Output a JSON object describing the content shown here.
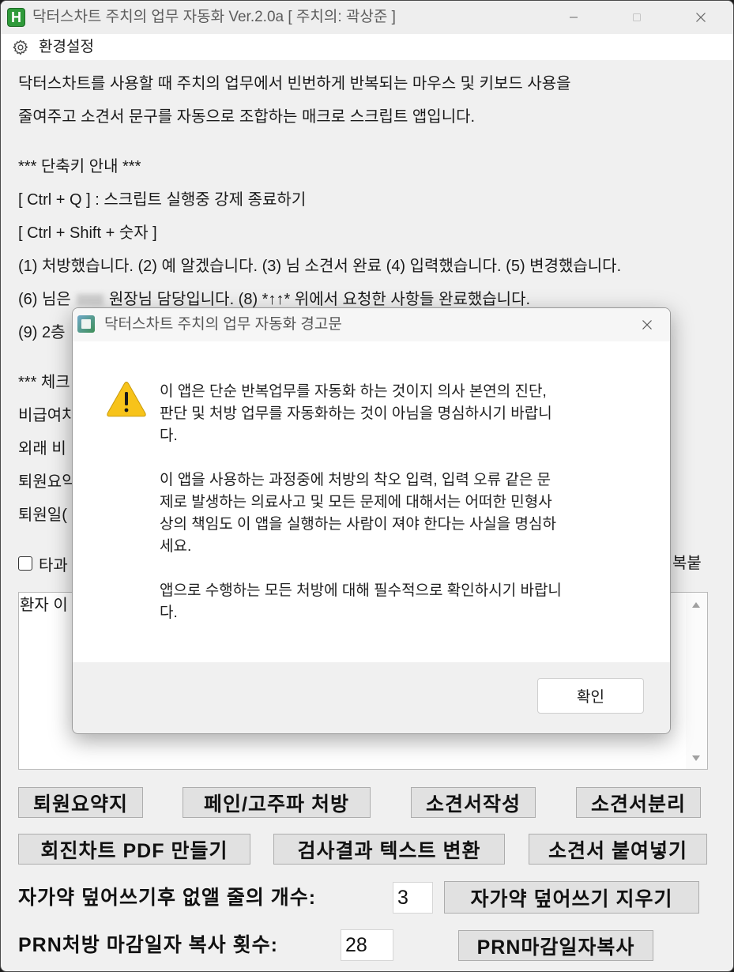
{
  "window": {
    "title": "닥터스차트 주치의 업무 자동화 Ver.2.0a [ 주치의: 곽상준 ]",
    "icon_letter": "H",
    "icon": "app-icon",
    "controls": [
      "minimize-icon",
      "maximize-icon",
      "close-icon"
    ]
  },
  "menu": {
    "settings": {
      "label": "환경설정",
      "icon": "gear-icon"
    }
  },
  "intro": [
    "닥터스차트를 사용할 때 주치의 업무에서 빈번하게 반복되는 마우스 및 키보드 사용을",
    "줄여주고 소견서 문구를 자동으로 조합하는 매크로 스크립트 앱입니다."
  ],
  "shortcuts": {
    "heading": "*** 단축키 안내 ***",
    "force_quit": "[ Ctrl + Q ] : 스크립트 실행중 강제 종료하기",
    "combo": "[ Ctrl + Shift + 숫자 ]",
    "phrases_line1": "(1) 처방했습니다. (2) 예 알겠습니다. (3) 님 소견서 완료 (4) 입력했습니다. (5) 변경했습니다.",
    "phrases_line2_before_name": "(6) 님은",
    "phrases_line2_after_name": "원장님 담당입니다. (8) *↑↑* 위에서 요청한 사항들 완료했습니다.",
    "phrases_line3": "(9) 2층"
  },
  "check_section": {
    "heading": "*** 체크",
    "lines": [
      "비급여차",
      "외래 비",
      "퇴원요약",
      "퇴원일("
    ]
  },
  "options": {
    "other_dept_checkbox": {
      "label": "타과",
      "checked": false
    },
    "right_label": "복붙"
  },
  "patient_box": {
    "text": "환자 이"
  },
  "buttons": {
    "row1": [
      "퇴원요약지",
      "페인/고주파 처방",
      "소견서작성",
      "소견서분리"
    ],
    "row2": [
      "회진차트 PDF 만들기",
      "검사결과 텍스트 변환",
      "소견서 붙여넣기"
    ]
  },
  "overwrite": {
    "label": "자가약 덮어쓰기후 없앨 줄의 개수:",
    "value": "3",
    "button": "자가약 덮어쓰기 지우기"
  },
  "prn": {
    "label": "PRN처방 마감일자 복사 횟수:",
    "value": "28",
    "button": "PRN마감일자복사"
  },
  "dialog": {
    "title": "닥터스차트 주치의 업무 자동화 경고문",
    "icon": "warning-icon",
    "paragraphs": [
      [
        "이 앱은 단순 반복업무를 자동화 하는 것이지 의사 본연의 진단,",
        "판단 및 처방 업무를 자동화하는 것이 아님을 명심하시기 바랍니",
        "다."
      ],
      [
        "이 앱을 사용하는 과정중에 처방의 착오 입력, 입력 오류 같은 문",
        "제로 발생하는 의료사고 및 모든 문제에 대해서는 어떠한 민형사",
        "상의 책임도 이 앱을 실행하는 사람이 져야 한다는 사실을 명심하",
        "세요."
      ],
      [
        "앱으로 수행하는 모든 처방에 대해 필수적으로 확인하시기 바랍니",
        "다."
      ]
    ],
    "ok_label": "확인"
  },
  "colors": {
    "window_bg": "#f0f0f0",
    "app_icon": "#2f9a3a",
    "button_bg": "#e1e1e1",
    "button_border": "#adadad",
    "warning": "#f7c31a"
  }
}
